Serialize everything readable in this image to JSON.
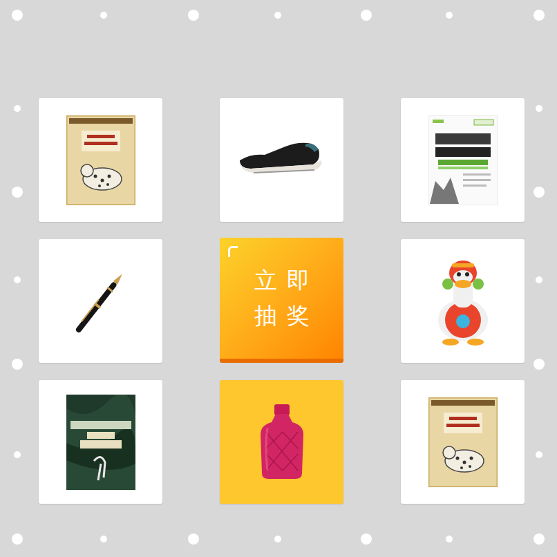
{
  "button": {
    "lines": [
      "立即",
      "抽奖"
    ]
  },
  "prizes": [
    {
      "kind": "cream-book",
      "selected": false
    },
    {
      "kind": "shoe",
      "selected": false
    },
    {
      "kind": "white-book",
      "selected": false
    },
    {
      "kind": "pen",
      "selected": false
    },
    {
      "kind": "toy",
      "selected": false
    },
    {
      "kind": "green-book",
      "selected": false
    },
    {
      "kind": "bottle",
      "selected": true
    },
    {
      "kind": "cream-book",
      "selected": false
    }
  ]
}
